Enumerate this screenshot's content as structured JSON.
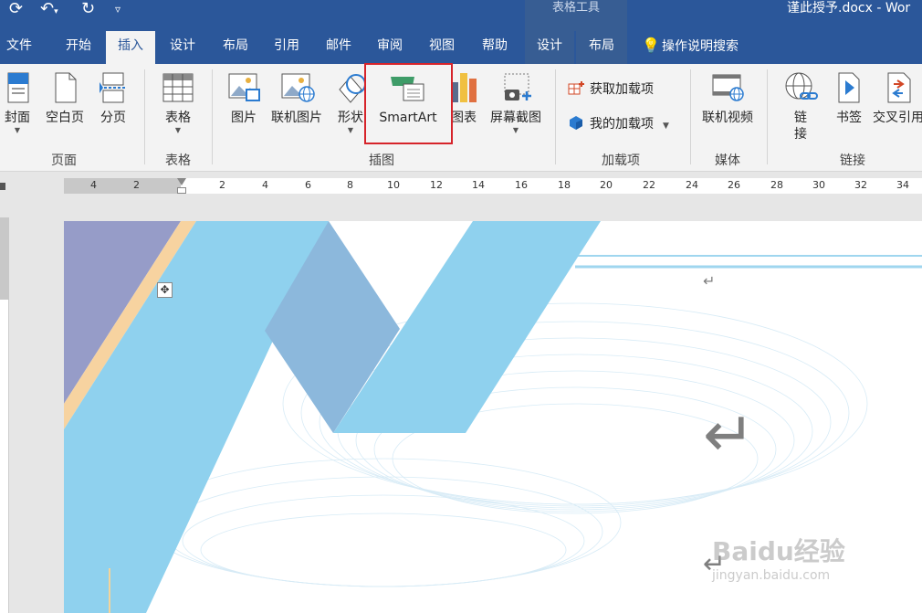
{
  "titlebar": {
    "context_group": "表格工具",
    "doc_title": "谨此授予.docx  -  Wor"
  },
  "tabs": [
    {
      "label": "文件"
    },
    {
      "label": "开始"
    },
    {
      "label": "插入"
    },
    {
      "label": "设计"
    },
    {
      "label": "布局"
    },
    {
      "label": "引用"
    },
    {
      "label": "邮件"
    },
    {
      "label": "审阅"
    },
    {
      "label": "视图"
    },
    {
      "label": "帮助"
    },
    {
      "label": "设计"
    },
    {
      "label": "布局"
    }
  ],
  "tell_me": "操作说明搜索",
  "ribbon": {
    "pages": {
      "label": "页面",
      "cover": "封面",
      "blank": "空白页",
      "break": "分页"
    },
    "tables": {
      "label": "表格",
      "table": "表格"
    },
    "illustrations": {
      "label": "插图",
      "picture": "图片",
      "online_picture": "联机图片",
      "shapes": "形状",
      "smartart": "SmartArt",
      "chart": "图表",
      "screenshot": "屏幕截图"
    },
    "addins": {
      "label": "加载项",
      "get": "获取加载项",
      "my": "我的加载项"
    },
    "media": {
      "label": "媒体",
      "online_video": "联机视频"
    },
    "links": {
      "label": "链接",
      "link": "链\n接",
      "bookmark": "书签",
      "crossref": "交叉引用"
    }
  },
  "ruler": {
    "left_numbers": [
      "4",
      "2"
    ],
    "numbers": [
      "2",
      "4",
      "6",
      "8",
      "10",
      "12",
      "14",
      "16",
      "18",
      "20",
      "22",
      "24",
      "26",
      "28",
      "30",
      "32",
      "34"
    ]
  },
  "watermark": {
    "brand": "Baidu经验",
    "url": "jingyan.baidu.com"
  },
  "colors": {
    "accent": "#2b579a",
    "highlight": "#d6232a",
    "band_blue": "#8fd1ee",
    "band_purple": "#969cc8",
    "band_orange": "#f7d3a0",
    "band_steel": "#8cb8dc"
  }
}
